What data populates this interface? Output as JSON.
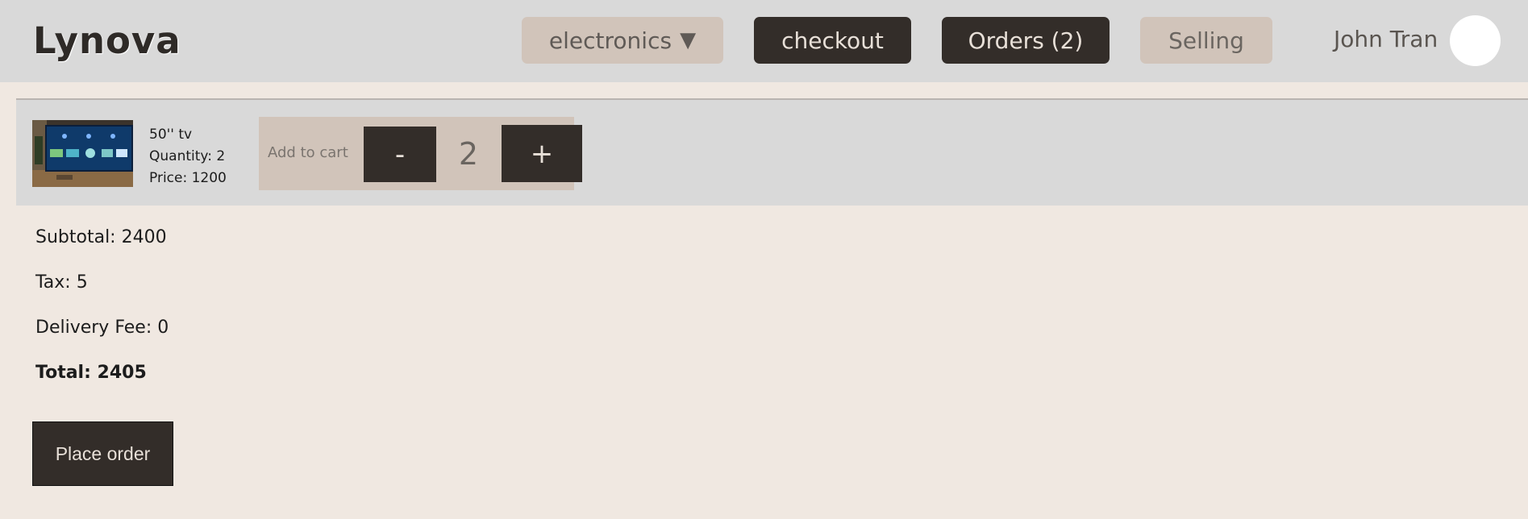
{
  "header": {
    "logo": "Lynova",
    "category_label": "electronics",
    "category_caret": "▼",
    "checkout_label": "checkout",
    "orders_label": "Orders (2)",
    "selling_label": "Selling",
    "user_name": "John Tran",
    "avatar_icon": "avatar-icon"
  },
  "cart": {
    "items": [
      {
        "name": "50'' tv",
        "quantity_text": "Quantity: 2",
        "price_text": "Price: 1200",
        "add_to_cart_label": "Add to cart",
        "minus_label": "-",
        "plus_label": "+",
        "quantity_value": "2",
        "thumbnail": "tv-product-image"
      }
    ]
  },
  "summary": {
    "subtotal": "Subtotal: 2400",
    "tax": "Tax: 5",
    "delivery_fee": "Delivery Fee: 0",
    "total": "Total: 2405"
  },
  "actions": {
    "place_order_label": "Place order"
  },
  "colors": {
    "header_bg": "#d9d9d9",
    "page_bg": "#f0e8e1",
    "dark_button": "#332d29",
    "light_button": "#d1c4ba"
  }
}
